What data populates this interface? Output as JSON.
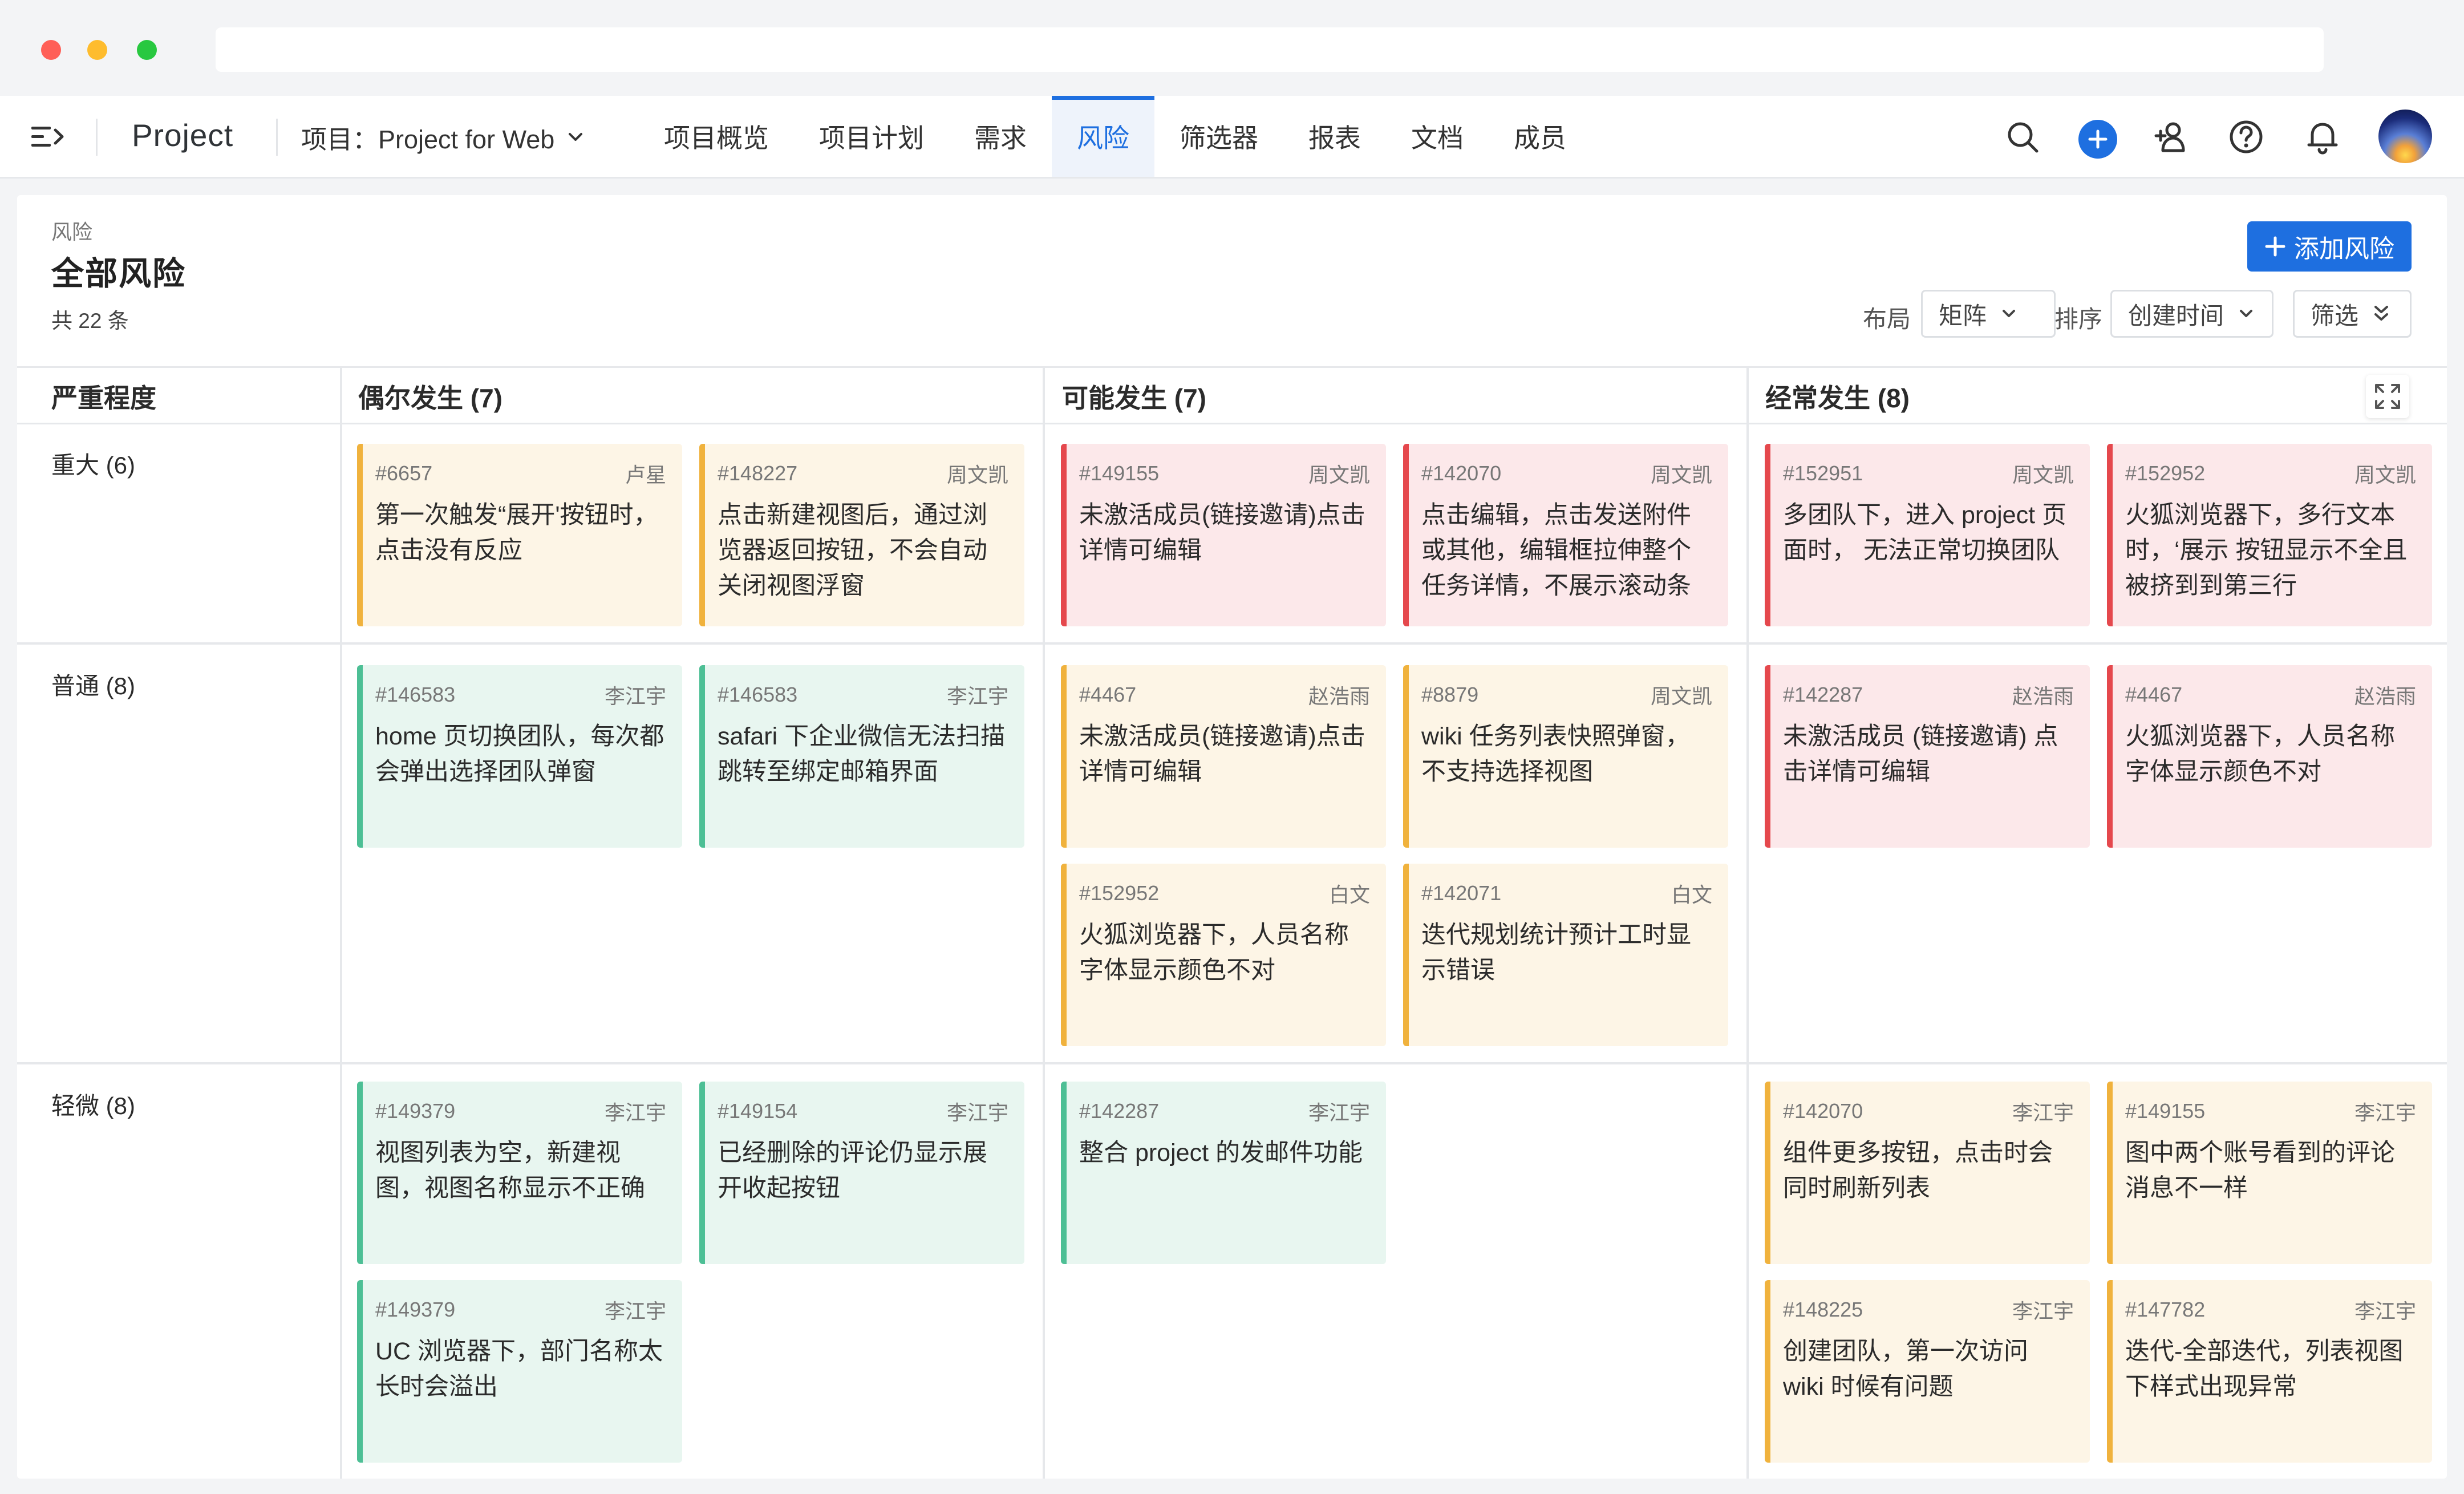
{
  "nav": {
    "app_name": "Project",
    "project_selector": "项目：Project for Web",
    "tabs": [
      {
        "label": "项目概览",
        "active": false
      },
      {
        "label": "项目计划",
        "active": false
      },
      {
        "label": "需求",
        "active": false
      },
      {
        "label": "风险",
        "active": true
      },
      {
        "label": "筛选器",
        "active": false
      },
      {
        "label": "报表",
        "active": false
      },
      {
        "label": "文档",
        "active": false
      },
      {
        "label": "成员",
        "active": false
      }
    ],
    "icons": [
      "search-icon",
      "add-icon",
      "add-user-icon",
      "help-icon",
      "bell-icon",
      "avatar"
    ]
  },
  "page": {
    "breadcrumb": "风险",
    "title": "全部风险",
    "count": "共 22 条",
    "add_button": "添加风险"
  },
  "toolbar": {
    "layout_label": "布局",
    "layout_value": "矩阵",
    "sort_label": "排序",
    "sort_value": "创建时间",
    "filter_label": "筛选"
  },
  "matrix": {
    "severity_header": "严重程度",
    "columns": [
      "偶尔发生 (7)",
      "可能发生 (7)",
      "经常发生 (8)"
    ],
    "rows": [
      "重大 (6)",
      "普通 (8)",
      "轻微 (8)"
    ]
  },
  "cards": [
    {
      "id": "#6657",
      "owner": "卢星",
      "title": "第一次触发“展开'按钮时，点击没有反应",
      "color": "yellow"
    },
    {
      "id": "#148227",
      "owner": "周文凯",
      "title": "点击新建视图后，通过浏览器返回按钮，不会自动关闭视图浮窗",
      "color": "yellow"
    },
    {
      "id": "#149155",
      "owner": "周文凯",
      "title": "未激活成员(链接邀请)点击详情可编辑",
      "color": "red"
    },
    {
      "id": "#142070",
      "owner": "周文凯",
      "title": "点击编辑，点击发送附件或其他，编辑框拉伸整个任务详情，不展示滚动条",
      "color": "red"
    },
    {
      "id": "#152951",
      "owner": "周文凯",
      "title": "多团队下，进入 project 页面时， 无法正常切换团队",
      "color": "red"
    },
    {
      "id": "#152952",
      "owner": "周文凯",
      "title": "火狐浏览器下，多行文本时，‘展示 按钮显示不全且被挤到到第三行",
      "color": "red"
    },
    {
      "id": "#146583",
      "owner": "李江宇",
      "title": "home 页切换团队，每次都会弹出选择团队弹窗",
      "color": "green"
    },
    {
      "id": "#146583",
      "owner": "李江宇",
      "title": "safari 下企业微信无法扫描跳转至绑定邮箱界面",
      "color": "green"
    },
    {
      "id": "#4467",
      "owner": "赵浩雨",
      "title": "未激活成员(链接邀请)点击详情可编辑",
      "color": "yellow"
    },
    {
      "id": "#8879",
      "owner": "周文凯",
      "title": "wiki 任务列表快照弹窗，不支持选择视图",
      "color": "yellow"
    },
    {
      "id": "#152952",
      "owner": "白文",
      "title": "火狐浏览器下，人员名称字体显示颜色不对",
      "color": "yellow"
    },
    {
      "id": "#142071",
      "owner": "白文",
      "title": "迭代规划统计预计工时显示错误",
      "color": "yellow"
    },
    {
      "id": "#142287",
      "owner": "赵浩雨",
      "title": "未激活成员 (链接邀请) 点击详情可编辑",
      "color": "red"
    },
    {
      "id": "#4467",
      "owner": "赵浩雨",
      "title": "火狐浏览器下，人员名称字体显示颜色不对",
      "color": "red"
    },
    {
      "id": "#149379",
      "owner": "李江宇",
      "title": "视图列表为空，新建视图，视图名称显示不正确",
      "color": "green"
    },
    {
      "id": "#149154",
      "owner": "李江宇",
      "title": "已经删除的评论仍显示展开收起按钮",
      "color": "green"
    },
    {
      "id": "#149379",
      "owner": "李江宇",
      "title": "UC 浏览器下，部门名称太长时会溢出",
      "color": "green"
    },
    {
      "id": "#142287",
      "owner": "李江宇",
      "title": "整合 project 的发邮件功能",
      "color": "green"
    },
    {
      "id": "#142070",
      "owner": "李江宇",
      "title": "组件更多按钮，点击时会同时刷新列表",
      "color": "yellow"
    },
    {
      "id": "#149155",
      "owner": "李江宇",
      "title": "图中两个账号看到的评论消息不一样",
      "color": "yellow"
    },
    {
      "id": "#148225",
      "owner": "李江宇",
      "title": "创建团队，第一次访问 wiki 时候有问题",
      "color": "yellow"
    },
    {
      "id": "#147782",
      "owner": "李江宇",
      "title": "迭代-全部迭代，列表视图下样式出现异常",
      "color": "yellow"
    }
  ],
  "colors": {
    "accent": "#1e6fe0",
    "card_yellow": "#fdf5e6",
    "card_red": "#fce8ea",
    "card_green": "#e8f6f0"
  }
}
